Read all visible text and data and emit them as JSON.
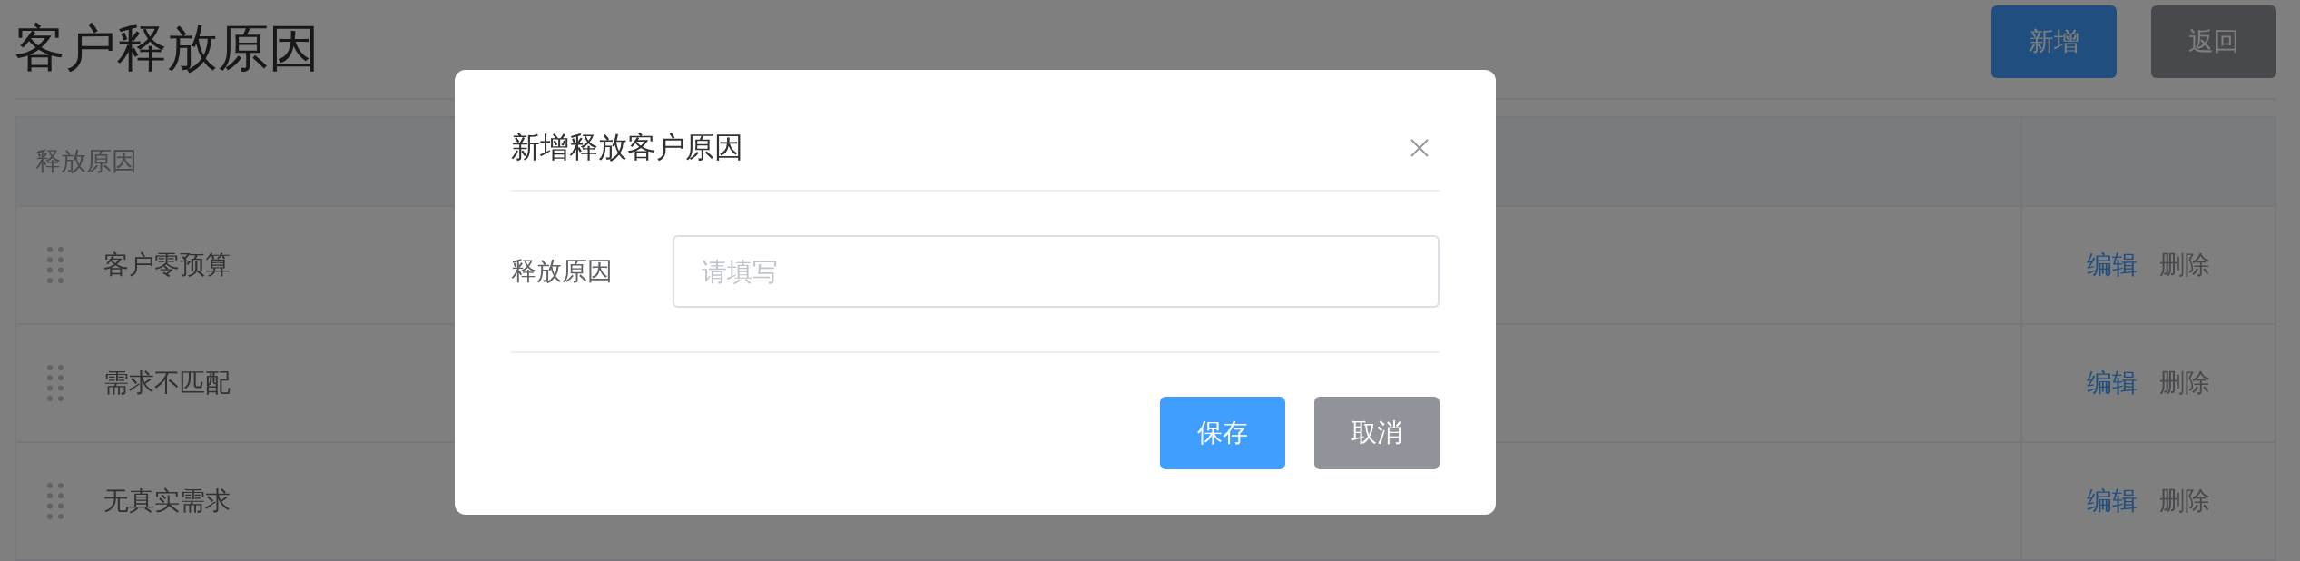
{
  "page": {
    "title": "客户释放原因"
  },
  "header_buttons": [
    {
      "label": "新增",
      "kind": "primary"
    },
    {
      "label": "返回",
      "kind": "secondary"
    }
  ],
  "table": {
    "columns": [
      "释放原因"
    ],
    "rows": [
      {
        "reason": "客户零预算",
        "actions": [
          {
            "label": "编辑",
            "kind": "primary"
          },
          {
            "label": "删除",
            "kind": "secondary"
          }
        ]
      },
      {
        "reason": "需求不匹配",
        "actions": [
          {
            "label": "编辑",
            "kind": "primary"
          },
          {
            "label": "删除",
            "kind": "secondary"
          }
        ]
      },
      {
        "reason": "无真实需求",
        "actions": [
          {
            "label": "编辑",
            "kind": "primary"
          },
          {
            "label": "删除",
            "kind": "secondary"
          }
        ]
      }
    ]
  },
  "dialog": {
    "title": "新增释放客户原因",
    "field": {
      "label": "释放原因",
      "placeholder": "请填写"
    },
    "buttons": [
      {
        "label": "保存",
        "kind": "primary"
      },
      {
        "label": "取消",
        "kind": "secondary"
      }
    ]
  }
}
